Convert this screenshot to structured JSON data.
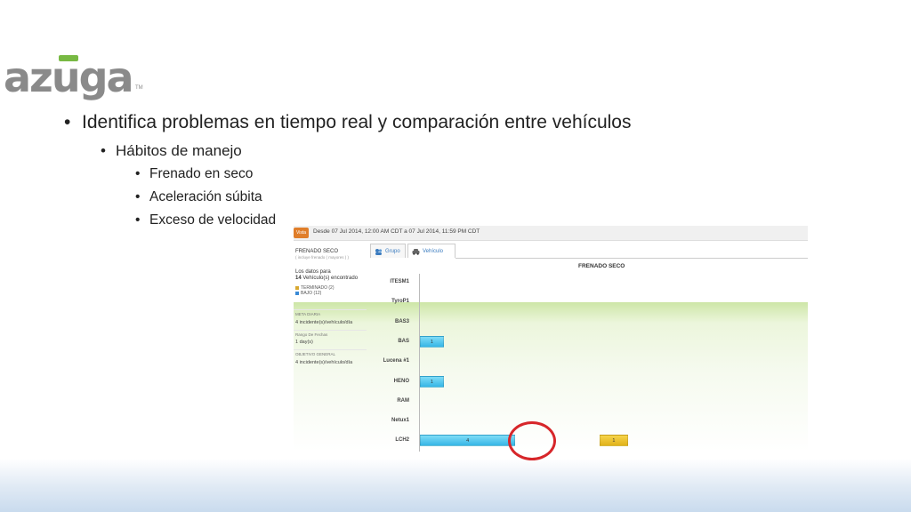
{
  "logo": {
    "text": "azuga",
    "tm": "TM"
  },
  "bullets": {
    "main": "Identifica problemas en tiempo real y comparación entre vehículos",
    "sub": "Hábitos de manejo",
    "items": [
      "Frenado en seco",
      "Aceleración súbita",
      "Exceso de velocidad"
    ]
  },
  "app": {
    "top_button": "Vista",
    "date_range": "Desde 07 Jul 2014, 12:00 AM CDT a 07 Jul 2014, 11:59 PM CDT",
    "tabs": [
      {
        "label": "Grupo",
        "icon": "group-icon"
      },
      {
        "label": "Vehículo",
        "icon": "car-icon"
      }
    ],
    "panel": {
      "title": "FRENADO SECO",
      "subtitle": "( incluye frenado ( mayores ) )",
      "data_for": "Los datos para",
      "count_num": "14",
      "count_text": " Vehículo(s) encontrado",
      "legend": [
        {
          "label": "TERMINADO (2)",
          "color": "#d8a830"
        },
        {
          "label": "BAJO (12)",
          "color": "#3a8ad6"
        }
      ],
      "sections": [
        {
          "heading": "META DIARIA",
          "value": "4 incidente(s)/vehículo/día"
        },
        {
          "heading": "Rango De Fechas",
          "value": "1 day(s)"
        },
        {
          "heading": "OBJETIVO GENERAL",
          "value": "4 incidente(s)/vehículo/día"
        }
      ]
    },
    "chart_data": {
      "type": "bar",
      "orientation": "horizontal",
      "title": "FRENADO SECO",
      "categories": [
        "ITESM1",
        "TyroP1",
        "BAS3",
        "BAS",
        "Lucena #1",
        "HENO",
        "RAM",
        "Netux1",
        "LCH2"
      ],
      "series": [
        {
          "color": "#36b6e6",
          "values": [
            0,
            0,
            0,
            1,
            0,
            1,
            0,
            0,
            4
          ]
        },
        {
          "color": "#e1b21b",
          "values": [
            0,
            0,
            0,
            0,
            0,
            0,
            0,
            0,
            1
          ]
        }
      ],
      "bar_labels": [
        null,
        null,
        null,
        "1",
        null,
        "1",
        null,
        null,
        "4"
      ],
      "extra_label": "1",
      "colors": {
        "highlight_circle": "#d7262a"
      }
    }
  }
}
